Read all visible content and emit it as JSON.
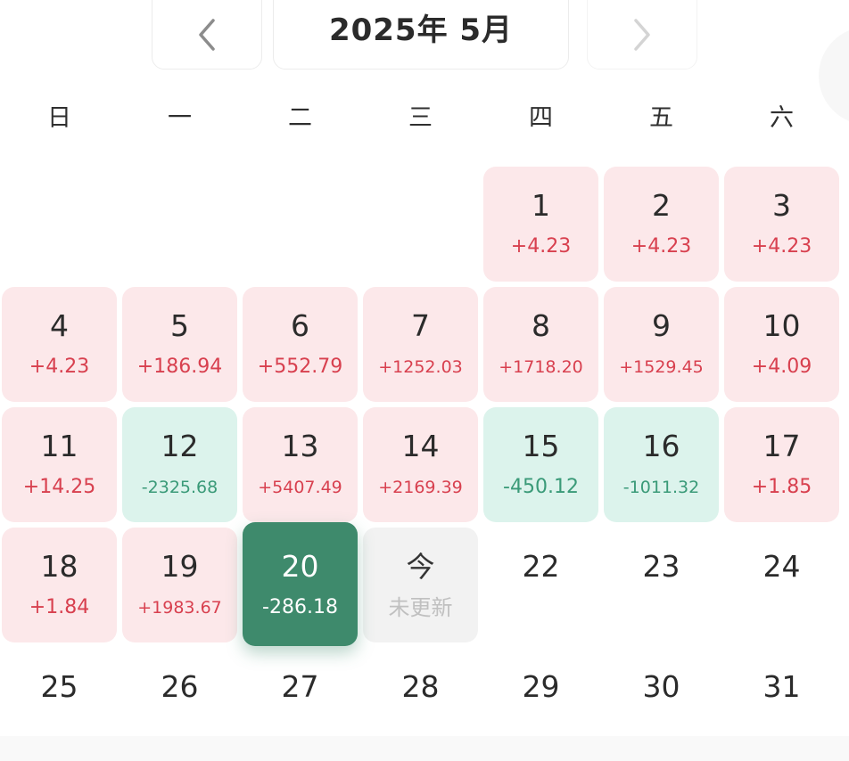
{
  "header": {
    "title": "2025年 5月",
    "prev_icon": "chevron-left-icon",
    "next_icon": "chevron-right-icon"
  },
  "weekdays": [
    "日",
    "一",
    "二",
    "三",
    "四",
    "五",
    "六"
  ],
  "colors": {
    "up_bg": "#fce8ea",
    "up_text": "#d8404f",
    "down_bg": "#dcf3ec",
    "down_text": "#3a9a78",
    "selected_bg": "#3e8a6c",
    "today_bg": "#f2f2f2"
  },
  "days": [
    {
      "label": "1",
      "change": "+4.23",
      "status": "up"
    },
    {
      "label": "2",
      "change": "+4.23",
      "status": "up"
    },
    {
      "label": "3",
      "change": "+4.23",
      "status": "up"
    },
    {
      "label": "4",
      "change": "+4.23",
      "status": "up"
    },
    {
      "label": "5",
      "change": "+186.94",
      "status": "up"
    },
    {
      "label": "6",
      "change": "+552.79",
      "status": "up"
    },
    {
      "label": "7",
      "change": "+1252.03",
      "status": "up"
    },
    {
      "label": "8",
      "change": "+1718.20",
      "status": "up"
    },
    {
      "label": "9",
      "change": "+1529.45",
      "status": "up"
    },
    {
      "label": "10",
      "change": "+4.09",
      "status": "up"
    },
    {
      "label": "11",
      "change": "+14.25",
      "status": "up"
    },
    {
      "label": "12",
      "change": "-2325.68",
      "status": "down"
    },
    {
      "label": "13",
      "change": "+5407.49",
      "status": "up"
    },
    {
      "label": "14",
      "change": "+2169.39",
      "status": "up"
    },
    {
      "label": "15",
      "change": "-450.12",
      "status": "down"
    },
    {
      "label": "16",
      "change": "-1011.32",
      "status": "down"
    },
    {
      "label": "17",
      "change": "+1.85",
      "status": "up"
    },
    {
      "label": "18",
      "change": "+1.84",
      "status": "up"
    },
    {
      "label": "19",
      "change": "+1983.67",
      "status": "up"
    },
    {
      "label": "20",
      "change": "-286.18",
      "status": "selected"
    },
    {
      "label": "今",
      "change": "未更新",
      "status": "today"
    },
    {
      "label": "22",
      "change": "",
      "status": "none"
    },
    {
      "label": "23",
      "change": "",
      "status": "none"
    },
    {
      "label": "24",
      "change": "",
      "status": "none"
    },
    {
      "label": "25",
      "change": "",
      "status": "none"
    },
    {
      "label": "26",
      "change": "",
      "status": "none"
    },
    {
      "label": "27",
      "change": "",
      "status": "none"
    },
    {
      "label": "28",
      "change": "",
      "status": "none"
    },
    {
      "label": "29",
      "change": "",
      "status": "none"
    },
    {
      "label": "30",
      "change": "",
      "status": "none"
    },
    {
      "label": "31",
      "change": "",
      "status": "none"
    }
  ]
}
